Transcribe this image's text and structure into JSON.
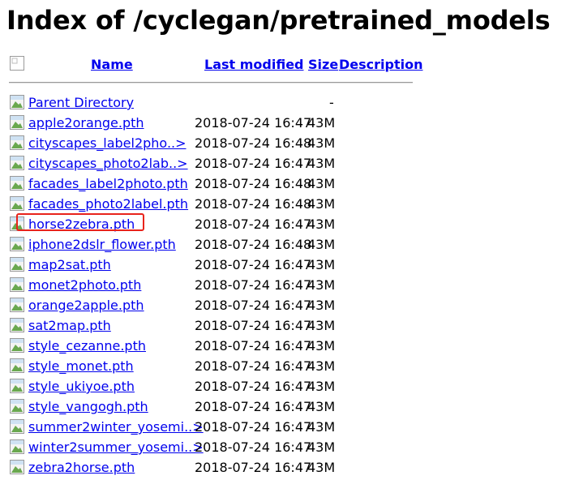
{
  "page": {
    "title": "Index of /cyclegan/pretrained_models"
  },
  "header": {
    "name": "Name",
    "last_modified": "Last modified",
    "size": "Size",
    "description": "Description"
  },
  "parent": {
    "label": "Parent Directory",
    "size": "-"
  },
  "files": [
    {
      "name": "apple2orange.pth",
      "modified": "2018-07-24 16:47",
      "size": "43M"
    },
    {
      "name": "cityscapes_label2pho..>",
      "modified": "2018-07-24 16:48",
      "size": "43M"
    },
    {
      "name": "cityscapes_photo2lab..>",
      "modified": "2018-07-24 16:47",
      "size": "43M"
    },
    {
      "name": "facades_label2photo.pth",
      "modified": "2018-07-24 16:48",
      "size": "43M"
    },
    {
      "name": "facades_photo2label.pth",
      "modified": "2018-07-24 16:48",
      "size": "43M"
    },
    {
      "name": "horse2zebra.pth",
      "modified": "2018-07-24 16:47",
      "size": "43M"
    },
    {
      "name": "iphone2dslr_flower.pth",
      "modified": "2018-07-24 16:48",
      "size": "43M"
    },
    {
      "name": "map2sat.pth",
      "modified": "2018-07-24 16:47",
      "size": "43M"
    },
    {
      "name": "monet2photo.pth",
      "modified": "2018-07-24 16:47",
      "size": "43M"
    },
    {
      "name": "orange2apple.pth",
      "modified": "2018-07-24 16:47",
      "size": "43M"
    },
    {
      "name": "sat2map.pth",
      "modified": "2018-07-24 16:47",
      "size": "43M"
    },
    {
      "name": "style_cezanne.pth",
      "modified": "2018-07-24 16:47",
      "size": "43M"
    },
    {
      "name": "style_monet.pth",
      "modified": "2018-07-24 16:47",
      "size": "43M"
    },
    {
      "name": "style_ukiyoe.pth",
      "modified": "2018-07-24 16:47",
      "size": "43M"
    },
    {
      "name": "style_vangogh.pth",
      "modified": "2018-07-24 16:47",
      "size": "43M"
    },
    {
      "name": "summer2winter_yosemi..>",
      "modified": "2018-07-24 16:47",
      "size": "43M"
    },
    {
      "name": "winter2summer_yosemi..>",
      "modified": "2018-07-24 16:47",
      "size": "43M"
    },
    {
      "name": "zebra2horse.pth",
      "modified": "2018-07-24 16:47",
      "size": "43M"
    }
  ],
  "icons": {
    "file": "broken-image-icon",
    "header": "blank-icon"
  },
  "colors": {
    "link": "#0000ee",
    "highlight": "#e8231b"
  }
}
